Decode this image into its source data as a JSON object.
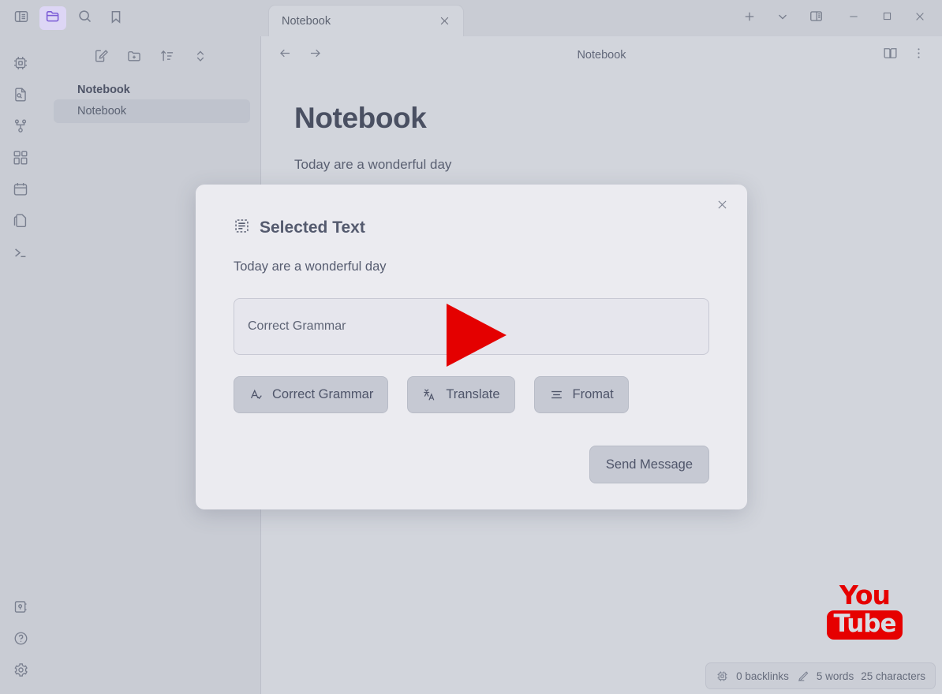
{
  "window": {
    "accent": "#7c5cd6",
    "left_buttons": [
      {
        "name": "toggle-sidebar-icon",
        "label": "Toggle Sidebar"
      },
      {
        "name": "folder-icon",
        "label": "Files",
        "active": true
      },
      {
        "name": "search-icon",
        "label": "Search"
      },
      {
        "name": "bookmark-icon",
        "label": "Bookmarks"
      }
    ],
    "tab": {
      "title": "Notebook",
      "close_label": "Close tab"
    },
    "actions": [
      {
        "name": "new-tab-icon",
        "label": "New tab"
      },
      {
        "name": "chevron-down-icon",
        "label": "Tab list"
      },
      {
        "name": "split-view-icon",
        "label": "Split view"
      },
      {
        "name": "minimize-icon",
        "label": "Minimize"
      },
      {
        "name": "maximize-icon",
        "label": "Maximize"
      },
      {
        "name": "close-window-icon",
        "label": "Close"
      }
    ]
  },
  "rail": {
    "items": [
      {
        "name": "chip-icon",
        "label": "AI"
      },
      {
        "name": "file-search-icon",
        "label": "File search"
      },
      {
        "name": "graph-icon",
        "label": "Graph view"
      },
      {
        "name": "dashboard-icon",
        "label": "Dashboard"
      },
      {
        "name": "calendar-icon",
        "label": "Calendar"
      },
      {
        "name": "copy-icon",
        "label": "Templates"
      },
      {
        "name": "terminal-icon",
        "label": "Terminal"
      }
    ],
    "bottom_items": [
      {
        "name": "vault-icon",
        "label": "Vault"
      },
      {
        "name": "help-icon",
        "label": "Help"
      },
      {
        "name": "gear-icon",
        "label": "Settings"
      }
    ]
  },
  "sidebar": {
    "toolbar": [
      {
        "name": "new-note-icon",
        "label": "New note"
      },
      {
        "name": "new-folder-icon",
        "label": "New folder"
      },
      {
        "name": "sort-icon",
        "label": "Sort"
      },
      {
        "name": "expand-collapse-icon",
        "label": "Expand / collapse"
      }
    ],
    "group_label": "Notebook",
    "items": [
      {
        "label": "Notebook",
        "selected": true
      }
    ]
  },
  "document": {
    "nav": [
      {
        "name": "back-arrow-icon",
        "label": "Back"
      },
      {
        "name": "forward-arrow-icon",
        "label": "Forward"
      }
    ],
    "title": "Notebook",
    "right_actions": [
      {
        "name": "reading-mode-icon",
        "label": "Reading mode"
      },
      {
        "name": "more-options-icon",
        "label": "More options"
      }
    ],
    "heading": "Notebook",
    "paragraph": "Today are a wonderful day"
  },
  "statusbar": {
    "backlinks_icon": "chip-icon",
    "backlinks": "0 backlinks",
    "edit_icon": "pencil-icon",
    "words": "5 words",
    "characters": "25 characters"
  },
  "watermark": {
    "name": "youtube-logo",
    "top": "You",
    "bottom": "Tube",
    "color": "#e60000"
  },
  "modal": {
    "close_label": "Close",
    "icon": "selected-text-icon",
    "title": "Selected Text",
    "selected_text": "Today are a wonderful day",
    "input_value": "Correct Grammar",
    "input_placeholder": "Correct Grammar",
    "chips": [
      {
        "icon": "grammar-check-icon",
        "label": "Correct Grammar"
      },
      {
        "icon": "translate-icon",
        "label": "Translate"
      },
      {
        "icon": "format-lines-icon",
        "label": "Fromat"
      }
    ],
    "send_label": "Send Message"
  },
  "cursor": {
    "name": "play-cursor-overlay",
    "color": "#e40000"
  }
}
